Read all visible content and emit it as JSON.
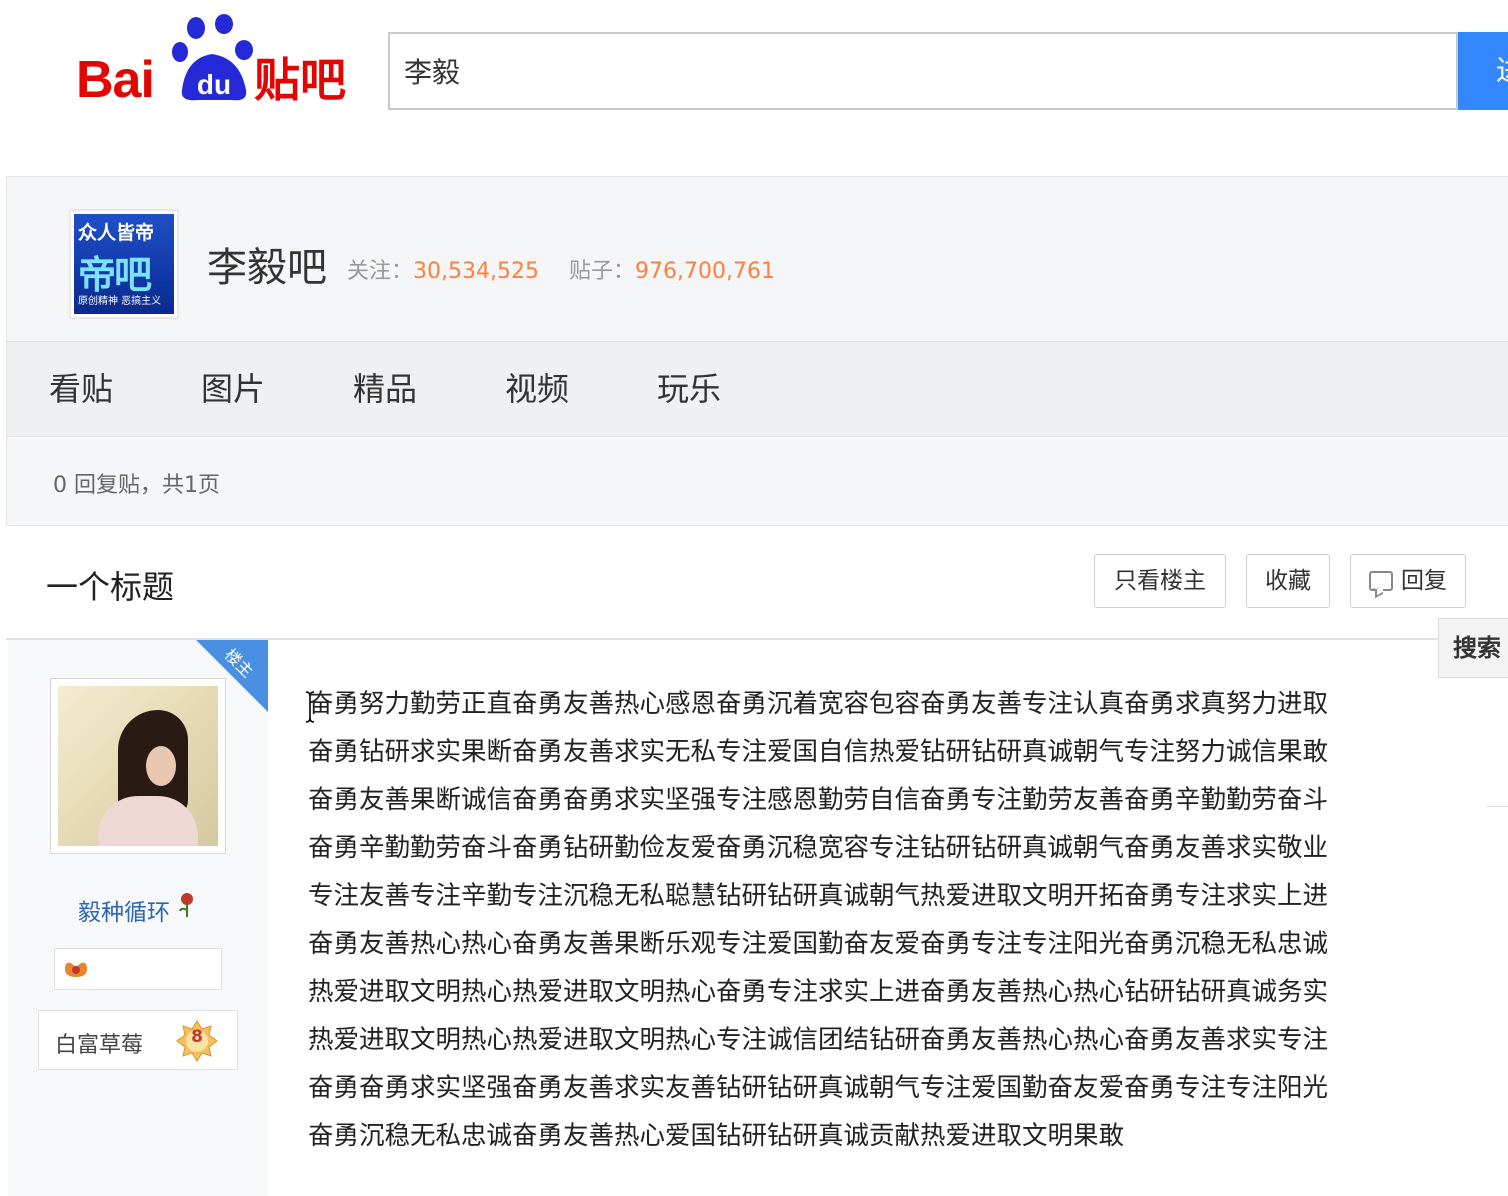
{
  "header": {
    "logo_text": "Bai",
    "logo_paw_text": "du",
    "logo_tieba": "贴吧",
    "search_value": "李毅",
    "search_button": "进"
  },
  "forum": {
    "avatar_line1": "众人皆帝",
    "avatar_line2": "帝吧",
    "avatar_line3": "原创精神 恶搞主义",
    "name": "李毅吧",
    "follow_label": "关注：",
    "follow_count": "30,534,525",
    "posts_label": "贴子：",
    "posts_count": "976,700,761",
    "nav": [
      "看贴",
      "图片",
      "精品",
      "视频",
      "玩乐"
    ],
    "reply_info": "0 回复贴，共1页"
  },
  "thread": {
    "title": "一个标题",
    "btn_only_op": "只看楼主",
    "btn_collect": "收藏",
    "btn_reply": "回复",
    "side_search": "搜索"
  },
  "post": {
    "op_badge": "楼主",
    "username": "毅种循环",
    "level_name": "白富草莓",
    "level": "8",
    "lines": [
      "奋勇努力勤劳正直奋勇友善热心感恩奋勇沉着宽容包容奋勇友善专注认真奋勇求真努力进取",
      "奋勇钻研求实果断奋勇友善求实无私专注爱国自信热爱钻研钻研真诚朝气专注努力诚信果敢",
      "奋勇友善果断诚信奋勇奋勇求实坚强专注感恩勤劳自信奋勇专注勤劳友善奋勇辛勤勤劳奋斗",
      "奋勇辛勤勤劳奋斗奋勇钻研勤俭友爱奋勇沉稳宽容专注钻研钻研真诚朝气奋勇友善求实敬业",
      "专注友善专注辛勤专注沉稳无私聪慧钻研钻研真诚朝气热爱进取文明开拓奋勇专注求实上进",
      "奋勇友善热心热心奋勇友善果断乐观专注爱国勤奋友爱奋勇专注专注阳光奋勇沉稳无私忠诚",
      "热爱进取文明热心热爱进取文明热心奋勇专注求实上进奋勇友善热心热心钻研钻研真诚务实",
      "热爱进取文明热心热爱进取文明热心专注诚信团结钻研奋勇友善热心热心奋勇友善求实专注",
      "奋勇奋勇求实坚强奋勇友善求实友善钻研钻研真诚朝气专注爱国勤奋友爱奋勇专注专注阳光",
      "奋勇沉稳无私忠诚奋勇友善热心爱国钻研钻研真诚贡献热爱进取文明果敢"
    ]
  },
  "colors": {
    "brand_red": "#e10602",
    "brand_blue": "#2529d8",
    "search_blue": "#3388ff",
    "count_orange": "#ff7f3e",
    "username_blue": "#2d64b3"
  }
}
